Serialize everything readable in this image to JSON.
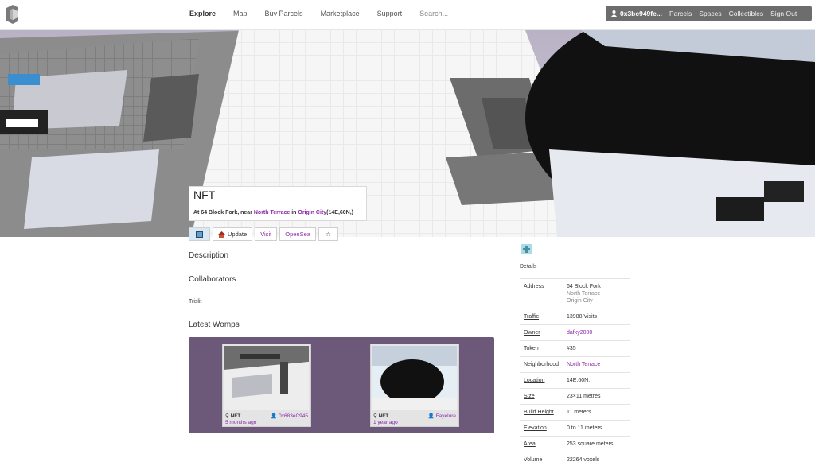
{
  "nav": {
    "items": [
      "Explore",
      "Map",
      "Buy Parcels",
      "Marketplace",
      "Support"
    ],
    "search_placeholder": "Search..."
  },
  "user": {
    "address": "0x3bc949fe...",
    "links": [
      "Parcels",
      "Spaces",
      "Collectibles",
      "Sign Out"
    ]
  },
  "parcel": {
    "title": "NFT",
    "location_prefix": "At 64 Block Fork, near ",
    "neighborhood": "North Terrace",
    "location_mid": " in ",
    "city": "Origin City",
    "coords": "(14E,60N,)"
  },
  "actions": {
    "update": "Update",
    "visit": "Visit",
    "opensea": "OpenSea",
    "star": "☆"
  },
  "sections": {
    "description": "Description",
    "collaborators": "Collaborators",
    "collaborator_name": "Trislit",
    "latest_womps": "Latest Womps"
  },
  "womps": [
    {
      "parcel": "NFT",
      "author": "0x683eC945",
      "time": "5 months ago"
    },
    {
      "parcel": "NFT",
      "author": "Fayelure",
      "time": "1 year ago"
    }
  ],
  "details": {
    "label": "Details",
    "rows": [
      {
        "key": "Address",
        "value": "64 Block Fork",
        "sub1": "North Terrace",
        "sub2": "Origin City"
      },
      {
        "key": "Traffic",
        "value": "13988 Visits"
      },
      {
        "key": "Owner",
        "value": "dafky2000",
        "link": true
      },
      {
        "key": "Token",
        "value": "#35"
      },
      {
        "key": "Neighborhood",
        "value": "North Terrace",
        "link": true
      },
      {
        "key": "Location",
        "value": "14E,60N,"
      },
      {
        "key": "Size",
        "value": "23×11 metres"
      },
      {
        "key": "Build Height",
        "value": "11 meters"
      },
      {
        "key": "Elevation",
        "value": "0 to 11 meters"
      },
      {
        "key": "Area",
        "value": "253 square meters"
      },
      {
        "key": "Volume",
        "value": "22264 voxels"
      }
    ]
  },
  "colors": {
    "accent": "#8a2aa8",
    "womps_bg": "#6c5878",
    "userbar_bg": "#6d6d6d"
  }
}
